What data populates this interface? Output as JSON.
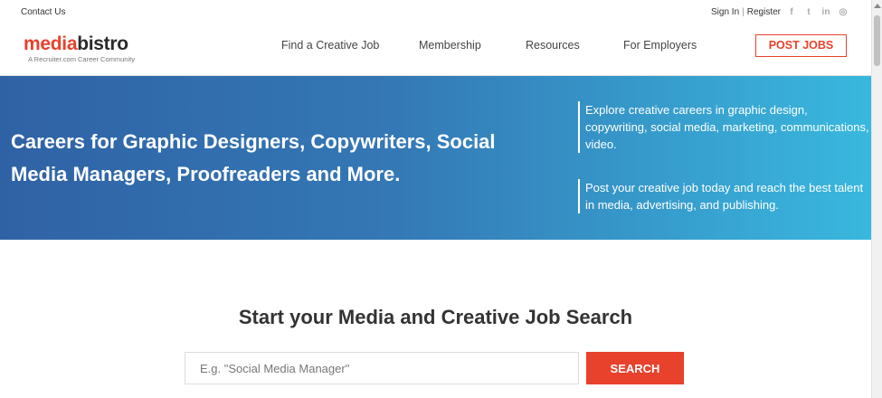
{
  "topbar": {
    "contact": "Contact Us",
    "sign_in": "Sign In",
    "separator": "|",
    "register": "Register",
    "social": [
      {
        "icon": "facebook-icon",
        "glyph": "f"
      },
      {
        "icon": "twitter-icon",
        "glyph": "t"
      },
      {
        "icon": "linkedin-icon",
        "glyph": "in"
      },
      {
        "icon": "instagram-icon",
        "glyph": "◎"
      }
    ]
  },
  "header": {
    "logo_media": "media",
    "logo_bistro": "bistro",
    "logo_tagline": "A Recruiter.com Career Community",
    "nav": [
      "Find a Creative Job",
      "Membership",
      "Resources",
      "For Employers"
    ],
    "post_jobs": "POST JOBS"
  },
  "hero": {
    "title": "Careers for Graphic Designers, Copywriters, Social Media Managers, Proofreaders and More.",
    "blurb_1": "Explore creative careers in graphic design, copywriting, social media, marketing, communications, video.",
    "blurb_2": "Post your creative job today and reach the best talent in media, advertising, and publishing."
  },
  "search": {
    "heading": "Start your Media and Creative Job Search",
    "placeholder": "E.g. \"Social Media Manager\"",
    "button": "SEARCH"
  },
  "colors": {
    "accent": "#e8412c",
    "hero_start": "#2f62a5",
    "hero_end": "#39b8de"
  }
}
